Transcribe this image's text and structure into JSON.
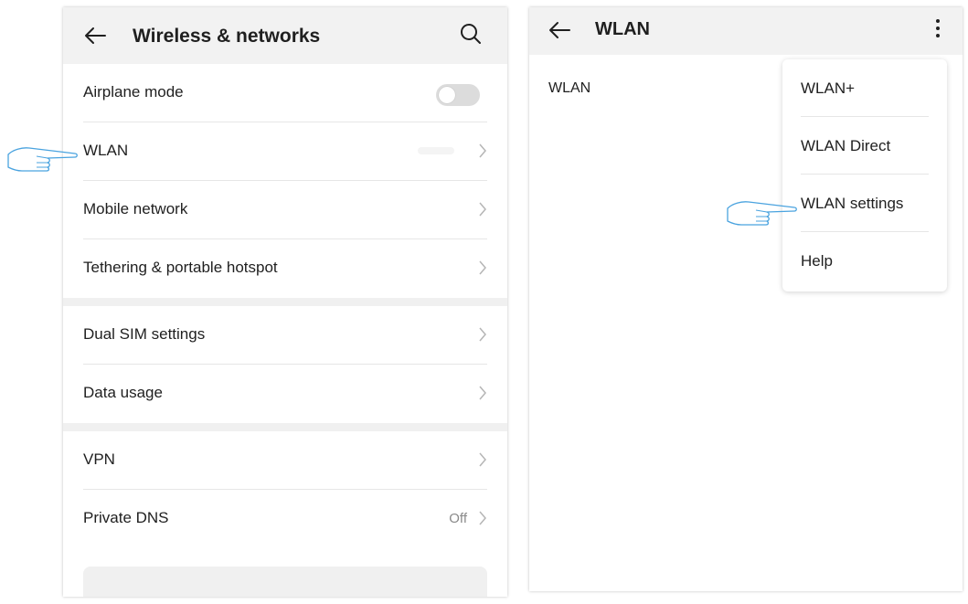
{
  "left_screen": {
    "title": "Wireless & networks",
    "icons": {
      "back": "back-arrow-icon",
      "search": "search-icon",
      "chevron": "chevron-right-icon"
    },
    "airplane_mode": {
      "label": "Airplane mode",
      "enabled": false
    },
    "items": [
      {
        "label": "WLAN",
        "value": ""
      },
      {
        "label": "Mobile network",
        "value": ""
      },
      {
        "label": "Tethering & portable hotspot",
        "value": ""
      },
      {
        "label": "Dual SIM settings",
        "value": ""
      },
      {
        "label": "Data usage",
        "value": ""
      },
      {
        "label": "VPN",
        "value": ""
      },
      {
        "label": "Private DNS",
        "value": "Off"
      }
    ]
  },
  "right_screen": {
    "title": "WLAN",
    "icons": {
      "back": "back-arrow-icon",
      "more": "more-vert-icon"
    },
    "wlan_label": "WLAN",
    "menu": [
      {
        "label": "WLAN+"
      },
      {
        "label": "WLAN Direct"
      },
      {
        "label": "WLAN settings"
      },
      {
        "label": "Help"
      }
    ]
  },
  "pointers": {
    "icon": "pointing-hand-icon",
    "color": "#4aa3df"
  },
  "colors": {
    "appbar_background": "#f2f2f2",
    "text": "#1f1f1f",
    "secondary_text": "#8a8a8a",
    "divider": "#e6e6e6",
    "toggle_off": "#dcdcdc",
    "pointer": "#4aa3df"
  }
}
